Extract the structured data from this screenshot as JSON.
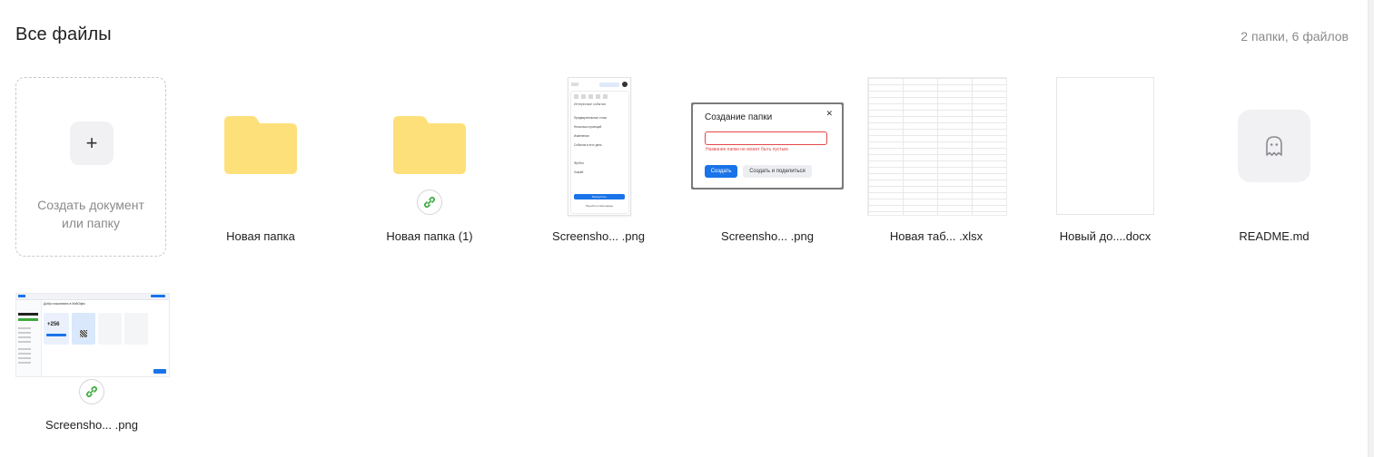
{
  "header": {
    "title": "Все файлы",
    "count": "2 папки, 6 файлов"
  },
  "create": {
    "line1": "Создать документ",
    "line2": "или папку",
    "plus": "+"
  },
  "items": [
    {
      "label": "Новая папка",
      "type": "folder",
      "shared": false
    },
    {
      "label": "Новая папка (1)",
      "type": "folder",
      "shared": true
    },
    {
      "label": "Screensho... .png",
      "type": "image",
      "shared": false
    },
    {
      "label": "Screensho... .png",
      "type": "image",
      "shared": false
    },
    {
      "label": "Новая таб... .xlsx",
      "type": "spreadsheet",
      "shared": false
    },
    {
      "label": "Новый до....docx",
      "type": "document",
      "shared": false
    },
    {
      "label": "README.md",
      "type": "markdown",
      "icon": "ghost-icon",
      "shared": false
    },
    {
      "label": "Screensho... .png",
      "type": "image",
      "shared": true
    }
  ],
  "thumbs": {
    "dialog": {
      "title": "Создание папки",
      "error": "Название папки не может быть пустым",
      "primary": "Создать",
      "secondary": "Создать и поделиться"
    },
    "menu": {
      "heading": "Интересные события",
      "items": [
        "Предварительные стоки",
        "Несколько проекций",
        "Изменения",
        "События в этот день",
        "Футбол",
        "Хоккей"
      ],
      "button": "Пропустить",
      "footer": "Перейти в Календарь"
    },
    "dashboard": {
      "value": "+256",
      "heading": "Добро пожаловать в МойОфис"
    }
  },
  "colors": {
    "folder": "#fde07a",
    "link": "#3daa3d",
    "accent": "#1a73e8",
    "error": "#e54848"
  }
}
